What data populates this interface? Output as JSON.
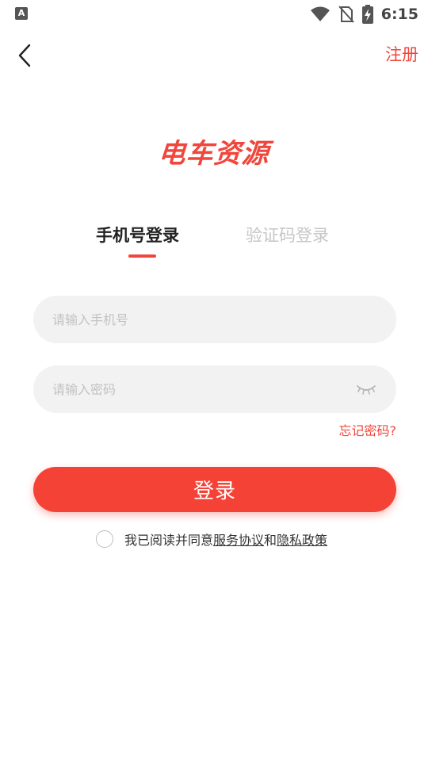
{
  "status_bar": {
    "time": "6:15",
    "left_icon": "A",
    "icons": [
      "wifi-icon",
      "no-sim-icon",
      "battery-charging-icon"
    ]
  },
  "header": {
    "back_icon": "chevron-left-icon",
    "register_label": "注册"
  },
  "logo": {
    "text": "电车资源"
  },
  "tabs": [
    {
      "label": "手机号登录",
      "active": true
    },
    {
      "label": "验证码登录",
      "active": false
    }
  ],
  "form": {
    "phone_placeholder": "请输入手机号",
    "phone_value": "",
    "password_placeholder": "请输入密码",
    "password_value": "",
    "eye_icon": "eye-closed-icon",
    "forgot_label": "忘记密码?",
    "login_label": "登录"
  },
  "agreement": {
    "checked": false,
    "prefix": "我已阅读并同意",
    "service_link": "服务协议",
    "conjunction": "和",
    "privacy_link": "隐私政策"
  },
  "colors": {
    "accent": "#f0463c",
    "button": "#f44336",
    "input_bg": "#f2f2f2",
    "tab_inactive": "#c6c6c6"
  }
}
